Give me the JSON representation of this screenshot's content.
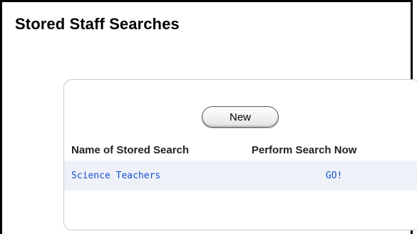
{
  "page": {
    "title": "Stored Staff Searches"
  },
  "toolbar": {
    "new_label": "New"
  },
  "table": {
    "headers": {
      "name": "Name of Stored Search",
      "perform": "Perform Search Now"
    },
    "rows": [
      {
        "name": "Science Teachers",
        "action": "GO!"
      }
    ]
  },
  "colors": {
    "link": "#1a4fd0",
    "row_bg": "#eef2f8"
  }
}
